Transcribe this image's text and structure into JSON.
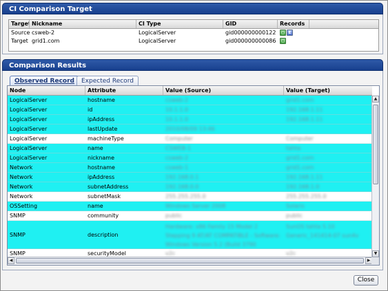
{
  "target_section": {
    "title": "CI Comparison Target",
    "columns": [
      "Target",
      "Nickname",
      "CI Type",
      "GID",
      "Records"
    ],
    "rows": [
      {
        "target": "Source",
        "nickname": "csweb-2",
        "ci_type": "LogicalServer",
        "gid": "gid000000000122",
        "records": [
          "observed-record-icon",
          "expected-record-icon"
        ]
      },
      {
        "target": "Target",
        "nickname": "grid1.com",
        "ci_type": "LogicalServer",
        "gid": "gid000000000086",
        "records": [
          "observed-record-icon"
        ]
      }
    ]
  },
  "results_section": {
    "title": "Comparison Results",
    "tabs": [
      {
        "label": "Observed Record",
        "active": true
      },
      {
        "label": "Expected Record",
        "active": false
      }
    ],
    "columns": [
      "Node",
      "Attribute",
      "Value (Source)",
      "Value (Target)"
    ],
    "rows": [
      {
        "node": "LogicalServer",
        "attribute": "hostname",
        "source": "csweb-2",
        "target": "grid1.com",
        "highlight": true,
        "lines": 1
      },
      {
        "node": "LogicalServer",
        "attribute": "id",
        "source": "10.1.1.0",
        "target": "192.168.1.11",
        "highlight": true,
        "lines": 1
      },
      {
        "node": "LogicalServer",
        "attribute": "ipAddress",
        "source": "10.1.1.0",
        "target": "192.168.1.11",
        "highlight": true,
        "lines": 1
      },
      {
        "node": "LogicalServer",
        "attribute": "lastUpdate",
        "source": "2010/08/09 13:46",
        "target": "",
        "highlight": true,
        "lines": 1
      },
      {
        "node": "LogicalServer",
        "attribute": "machineType",
        "source": "Computer",
        "target": "Computer",
        "highlight": false,
        "lines": 1
      },
      {
        "node": "LogicalServer",
        "attribute": "name",
        "source": "CSWEB-1",
        "target": "tahta",
        "highlight": true,
        "lines": 1
      },
      {
        "node": "LogicalServer",
        "attribute": "nickname",
        "source": "csweb-2",
        "target": "grid1.com",
        "highlight": true,
        "lines": 1
      },
      {
        "node": "Network",
        "attribute": "hostname",
        "source": "csweb-1",
        "target": "grid1.com",
        "highlight": true,
        "lines": 1
      },
      {
        "node": "Network",
        "attribute": "ipAddress",
        "source": "192.168.0.1",
        "target": "192.168.1.11",
        "highlight": true,
        "lines": 1
      },
      {
        "node": "Network",
        "attribute": "subnetAddress",
        "source": "192.168.0.0",
        "target": "192.168.1.0",
        "highlight": true,
        "lines": 1
      },
      {
        "node": "Network",
        "attribute": "subnetMask",
        "source": "255.255.255.0",
        "target": "255.255.255.0",
        "highlight": false,
        "lines": 1
      },
      {
        "node": "OSSetting",
        "attribute": "name",
        "source": "Windows Server 2008",
        "target": "Solaris",
        "highlight": true,
        "lines": 1
      },
      {
        "node": "SNMP",
        "attribute": "community",
        "source": "public",
        "target": "public",
        "highlight": false,
        "lines": 1
      },
      {
        "node": "SNMP",
        "attribute": "description",
        "source": "Hardware: x86 Family 15 Model 2 Stepping 9 AT/AT COMPATIBLE - Software: Windows Version 5.2 (Build 3790 Multiprocessor Free)",
        "target": "SunOS tahta 5.10 Generic_141414-07 sun4v",
        "highlight": true,
        "lines": 3
      },
      {
        "node": "SNMP",
        "attribute": "securityModel",
        "source": "v2c",
        "target": "v2c",
        "highlight": false,
        "lines": 1
      }
    ]
  },
  "footer": {
    "close_label": "Close"
  }
}
